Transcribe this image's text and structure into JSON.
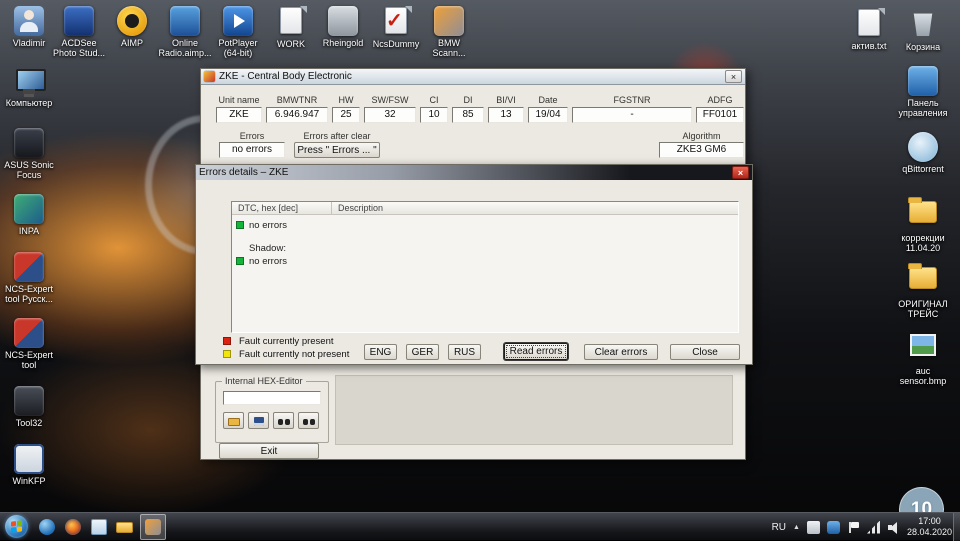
{
  "chrome": {
    "close": "×"
  },
  "colors": {
    "fault_present": "#dd2211",
    "fault_not_present": "#f2e50a",
    "no_fault": "#14b33a"
  },
  "desktop": {
    "left_icons": [
      {
        "label": "Vladimir"
      },
      {
        "label": "Компьютер"
      },
      {
        "label": "ASUS Sonic Focus"
      },
      {
        "label": "INPA"
      },
      {
        "label": "NCS-Expert tool Русск..."
      },
      {
        "label": "NCS-Expert tool"
      },
      {
        "label": "Tool32"
      },
      {
        "label": "WinKFP"
      }
    ],
    "top_icons": [
      {
        "label": "ACDSee Photo Stud..."
      },
      {
        "label": "AIMP"
      },
      {
        "label": "Online Radio.aimp..."
      },
      {
        "label": "PotPlayer (64-bit)"
      },
      {
        "label": "WORK"
      },
      {
        "label": "Rheingold"
      },
      {
        "label": "NcsDummy"
      },
      {
        "label": "BMW Scann..."
      }
    ],
    "right_icons": [
      {
        "label": "актив.txt"
      },
      {
        "label": "Корзина"
      },
      {
        "label": "Панель управления"
      },
      {
        "label": "qBittorrent"
      },
      {
        "label": "коррекции 11.04.20"
      },
      {
        "label": "ОРИГИНАЛ ТРЕЙС"
      },
      {
        "label": "auc sensor.bmp"
      }
    ]
  },
  "zke": {
    "title": "ZKE - Central Body Electronic",
    "fields": [
      {
        "label": "Unit name",
        "value": "ZKE"
      },
      {
        "label": "BMWTNR",
        "value": "6.946.947"
      },
      {
        "label": "HW",
        "value": "25"
      },
      {
        "label": "SW/FSW",
        "value": "32"
      },
      {
        "label": "CI",
        "value": "10"
      },
      {
        "label": "DI",
        "value": "85"
      },
      {
        "label": "BI/VI",
        "value": "13"
      },
      {
        "label": "Date",
        "value": "19/04"
      },
      {
        "label": "FGSTNR",
        "value": "-"
      },
      {
        "label": "ADFG",
        "value": "FF0101"
      }
    ],
    "errors_label": "Errors",
    "errors_value": "no errors",
    "after_clear_label": "Errors after clear",
    "errors_button": "Press \" Errors ... \"",
    "algorithm_label": "Algorithm",
    "algorithm_value": "ZKE3 GM6",
    "hex_editor_title": "Internal HEX-Editor",
    "exit_button": "Exit"
  },
  "errors_win": {
    "title": "Errors details – ZKE",
    "col_dtc": "DTC, hex [dec]",
    "col_desc": "Description",
    "row1": "no errors",
    "row_shadow": "Shadow:",
    "row2": "no errors",
    "legend_present": "Fault currently present",
    "legend_not_present": "Fault currently not present",
    "btn_eng": "ENG",
    "btn_ger": "GER",
    "btn_rus": "RUS",
    "btn_read": "Read errors",
    "btn_clear": "Clear errors",
    "btn_close": "Close"
  },
  "taskbar": {
    "lang": "RU",
    "chevron": "▲",
    "time": "17:00",
    "date": "28.04.2020"
  },
  "badge": {
    "text": "10"
  }
}
